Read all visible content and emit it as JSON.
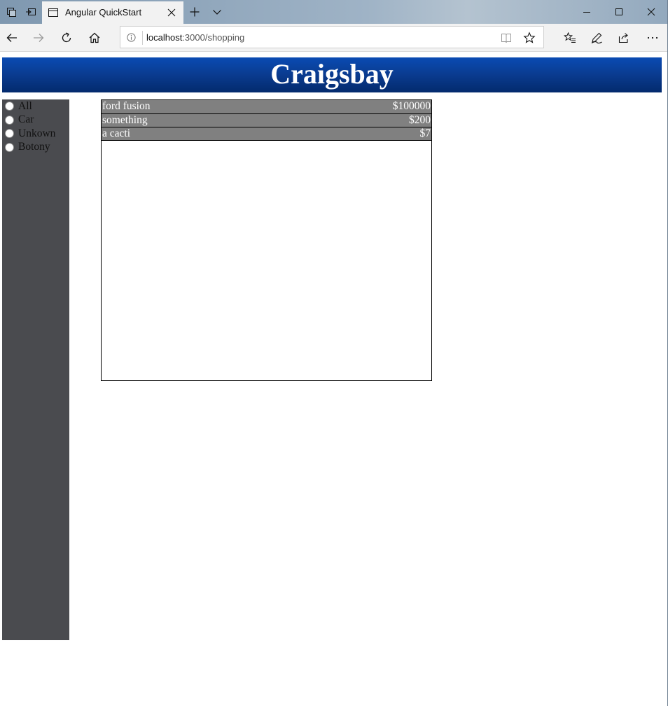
{
  "browser": {
    "tab_title": "Angular QuickStart",
    "url_host": "localhost",
    "url_path": ":3000/shopping"
  },
  "page": {
    "title": "Craigsbay",
    "categories": [
      {
        "label": "All"
      },
      {
        "label": "Car"
      },
      {
        "label": "Unkown"
      },
      {
        "label": "Botony"
      }
    ],
    "items": [
      {
        "name": "ford fusion",
        "price": "$100000"
      },
      {
        "name": "something",
        "price": "$200"
      },
      {
        "name": "a cacti",
        "price": "$7"
      }
    ]
  },
  "colors": {
    "header_blue": "#0a3b8f",
    "sidebar_gray": "#4a4b4f",
    "row_gray": "#808080"
  }
}
